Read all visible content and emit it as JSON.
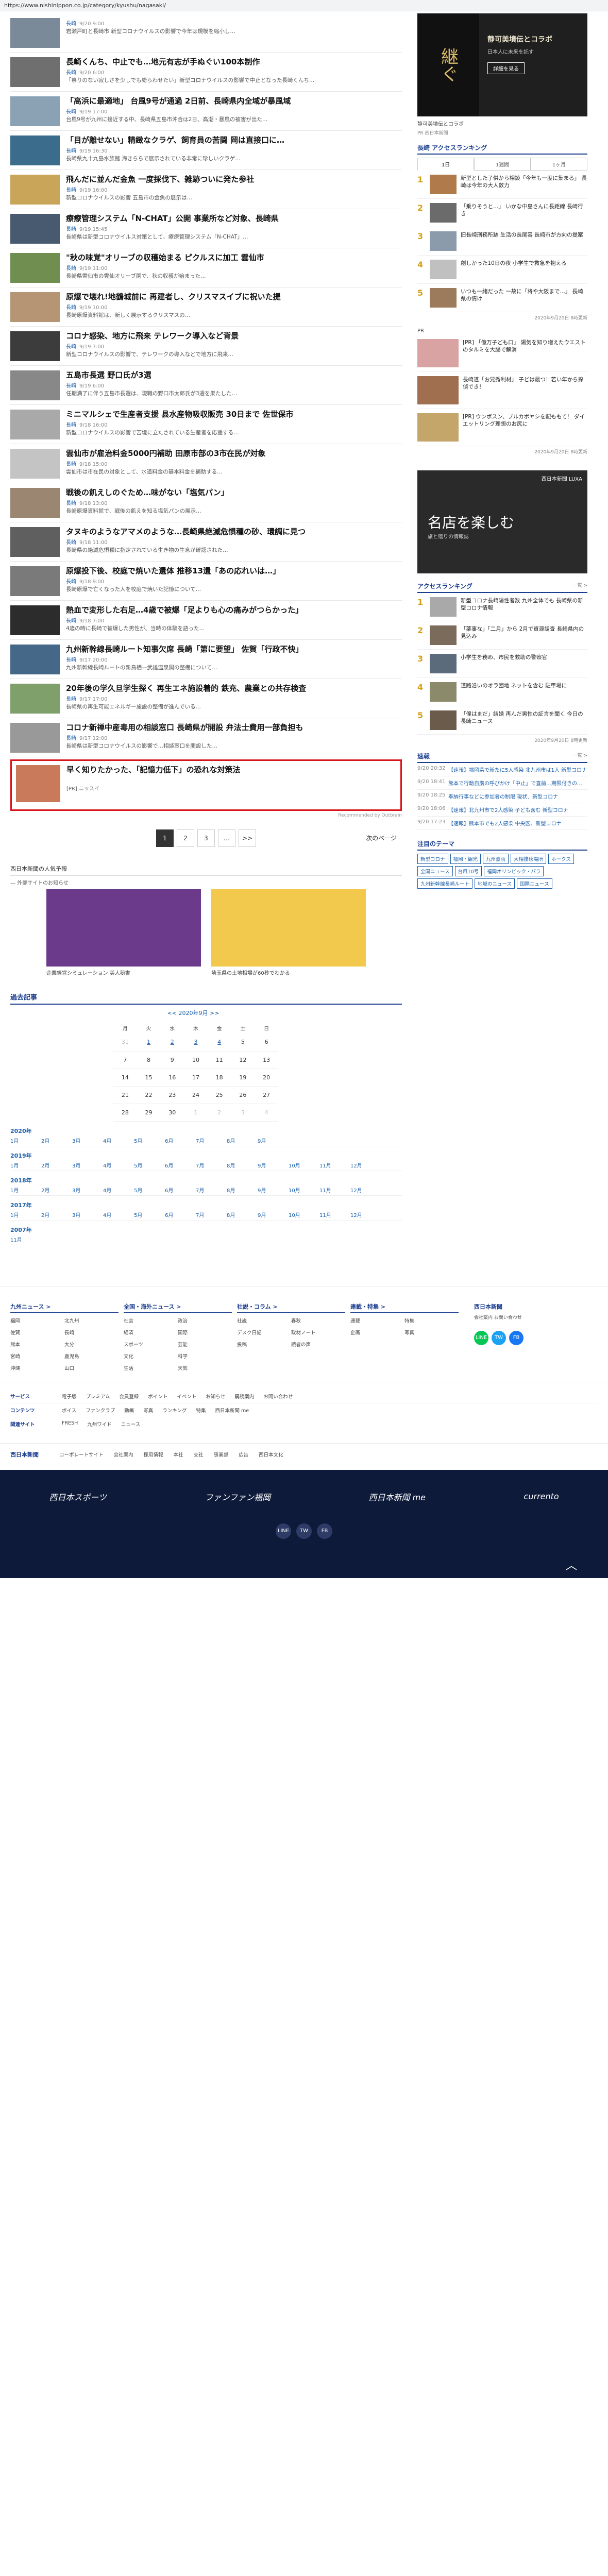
{
  "url": "https://www.nishinippon.co.jp/category/kyushu/nagasaki/",
  "articles": [
    {
      "title": "",
      "cat": "長崎",
      "time": "9/20 9:00",
      "lead": "岩瀬戸町と長崎市 新型コロナウイルスの影響で今年は規模を縮小し…",
      "color": "#7b8a99"
    },
    {
      "title": "長崎くんち、中止でも…地元有志が手ぬぐい100本制作",
      "cat": "長崎",
      "time": "9/20 6:00",
      "lead": "「祭りのない寂しさを少しでも紛らわせたい」新型コロナウイルスの影響で中止となった長崎くんち…",
      "color": "#6f6f6f"
    },
    {
      "title": "「高浜に最適地」 台風9号が通過 2日前、長崎県内全域が暴風域",
      "cat": "長崎",
      "time": "9/19 17:00",
      "lead": "台風9号が九州に接近する中、長崎県五島市沖合は2日、高潮・暴風の被害が出た…",
      "color": "#8aa2b4"
    },
    {
      "title": "「目が離せない」精緻なクラゲ、飼育員の苦闘 岡は直接口に…",
      "cat": "長崎",
      "time": "9/19 16:30",
      "lead": "長崎県九十九島水族館 海きららで展示されている非常に珍しいクラゲ…",
      "color": "#3b6c8c"
    },
    {
      "title": "飛んだに並んだ金魚 一度採伐下、雑跡ついに発た参社",
      "cat": "長崎",
      "time": "9/19 16:00",
      "lead": "新型コロナウイルスの影響 五島市の金魚の展示は…",
      "color": "#c9a55a"
    },
    {
      "title": "療療管理システム「N-CHAT」公開 事業所など対象、長崎県",
      "cat": "長崎",
      "time": "9/19 15:45",
      "lead": "長崎県は新型コロナウイルス対策として、療療管理システム「N-CHAT」…",
      "color": "#485a6f"
    },
    {
      "title": "\"秋の味覚\"オリーブの収穫始まる ピクルスに加工 雲仙市",
      "cat": "長崎",
      "time": "9/19 11:00",
      "lead": "長崎県雲仙市の雲仙オリーブ園で、秋の収穫が始まった…",
      "color": "#6f8e4f"
    },
    {
      "title": "原爆で壊れ!地鶴城前に 再建者し、クリスマスイブに祝いた提",
      "cat": "長崎",
      "time": "9/19 10:00",
      "lead": "長崎原爆資料館は、新しく展示するクリスマスの…",
      "color": "#b59574"
    },
    {
      "title": "コロナ感染、地方に飛来 テレワーク導入など背景",
      "cat": "長崎",
      "time": "9/19 7:00",
      "lead": "新型コロナウイルスの影響で、テレワークの導入などで地方に飛来…",
      "color": "#3c3c3c"
    },
    {
      "title": "五島市長選 野口氏が3選",
      "cat": "長崎",
      "time": "9/19 6:00",
      "lead": "任期満了に伴う五島市長選は、現職の野口市太郎氏が3選を果たした…",
      "color": "#888"
    },
    {
      "title": "ミニマルシェで生産者支援 县水産物吸収販売 30日まで 佐世保市",
      "cat": "長崎",
      "time": "9/18 16:00",
      "lead": "新型コロナウイルスの影響で苦境に立たされている生産者を応援する…",
      "color": "#a9a9a9"
    },
    {
      "title": "雲仙市が雇治料金5000円補助 田原市部の3市在民が対象",
      "cat": "長崎",
      "time": "9/18 15:00",
      "lead": "雲仙市は市在民の対象として、水道料金の基本料金を補助する…",
      "color": "#c4c4c4"
    },
    {
      "title": "戦後の飢えしのぐため…味がない「塩気パン」",
      "cat": "長崎",
      "time": "9/18 13:00",
      "lead": "長崎原爆資料館で、戦後の飢えを知る塩気パンの展示…",
      "color": "#9a8671"
    },
    {
      "title": "タヌキのようなアマメのような…長崎県絶滅危惧種の砂、環調に見つ",
      "cat": "長崎",
      "time": "9/18 11:00",
      "lead": "長崎県の絶滅危惧種に指定されている生き物の生息が確認された…",
      "color": "#5f5f5f"
    },
    {
      "title": "原爆投下後、校庭で焼いた遺体 推移13遺「あの応れいは…」",
      "cat": "長崎",
      "time": "9/18 9:00",
      "lead": "長崎原爆で亡くなった人を校庭で焼いた記憶について…",
      "color": "#7a7a7a"
    },
    {
      "title": "熱血で変形した右足…4歳で被爆「足よりも心の痛みがつらかった」",
      "cat": "長崎",
      "time": "9/18 7:00",
      "lead": "4歳の時に長崎で被爆した男性が、当時の体験を語った…",
      "color": "#2c2c2c"
    },
    {
      "title": "九州新幹線長崎ルート知事欠席 長崎「第に要望」 佐賀「行政不快」",
      "cat": "長崎",
      "time": "9/17 20:00",
      "lead": "九州新幹線長崎ルートの新鳥栖―武雄温泉間の整備について…",
      "color": "#456788"
    },
    {
      "title": "20年後の学久旦学生探く 再生エネ施設着的 鉄充、農業との共存検査",
      "cat": "長崎",
      "time": "9/17 17:00",
      "lead": "長崎県の再生可能エネルギー施設の整備が進んでいる…",
      "color": "#7fa06a"
    },
    {
      "title": "コロナ新禅中産毒用の相談窓口 長崎県が開設 弁法士費用一部負担も",
      "cat": "長崎",
      "time": "9/17 12:00",
      "lead": "長崎県は新型コロナウイルスの影響で…相談窓口を開設した…",
      "color": "#999"
    }
  ],
  "pr_article": {
    "title": "早く知りたかった、「記憶力低下」の恐れな対策法",
    "tag": "[PR] ニッスイ",
    "color": "#c97a5a"
  },
  "recommend_label": "Recommended by Outbrain",
  "pager": {
    "pages": [
      "1",
      "2",
      "3",
      "…",
      ">>"
    ],
    "next": "次のページ"
  },
  "promo": {
    "heading": "西日本新聞の人気予報",
    "sub": "— 外部サイトのお知らせ",
    "cards": [
      {
        "caption": "企業経営シミュレーション 美人秘書",
        "color": "#6b3a8a"
      },
      {
        "caption": "埼玉県の土地相場が60秒でわかる",
        "color": "#f2c94c"
      }
    ]
  },
  "archive": {
    "heading": "過去記事",
    "month_title": "<< 2020年9月 >>",
    "weekdays": [
      "月",
      "火",
      "水",
      "木",
      "金",
      "土",
      "日"
    ],
    "weeks": [
      [
        {
          "d": "31",
          "c": "dim"
        },
        {
          "d": "1",
          "c": "link"
        },
        {
          "d": "2",
          "c": "link"
        },
        {
          "d": "3",
          "c": "link"
        },
        {
          "d": "4",
          "c": "link"
        },
        {
          "d": "5",
          "c": ""
        },
        {
          "d": "6",
          "c": ""
        }
      ],
      [
        {
          "d": "7",
          "c": ""
        },
        {
          "d": "8",
          "c": ""
        },
        {
          "d": "9",
          "c": ""
        },
        {
          "d": "10",
          "c": ""
        },
        {
          "d": "11",
          "c": ""
        },
        {
          "d": "12",
          "c": ""
        },
        {
          "d": "13",
          "c": ""
        }
      ],
      [
        {
          "d": "14",
          "c": ""
        },
        {
          "d": "15",
          "c": ""
        },
        {
          "d": "16",
          "c": ""
        },
        {
          "d": "17",
          "c": ""
        },
        {
          "d": "18",
          "c": ""
        },
        {
          "d": "19",
          "c": ""
        },
        {
          "d": "20",
          "c": ""
        }
      ],
      [
        {
          "d": "21",
          "c": ""
        },
        {
          "d": "22",
          "c": ""
        },
        {
          "d": "23",
          "c": ""
        },
        {
          "d": "24",
          "c": ""
        },
        {
          "d": "25",
          "c": ""
        },
        {
          "d": "26",
          "c": ""
        },
        {
          "d": "27",
          "c": ""
        }
      ],
      [
        {
          "d": "28",
          "c": ""
        },
        {
          "d": "29",
          "c": ""
        },
        {
          "d": "30",
          "c": ""
        },
        {
          "d": "1",
          "c": "dim"
        },
        {
          "d": "2",
          "c": "dim"
        },
        {
          "d": "3",
          "c": "dim"
        },
        {
          "d": "4",
          "c": "dim"
        }
      ]
    ],
    "years": [
      {
        "year": "2020年",
        "months": [
          "1月",
          "2月",
          "3月",
          "4月",
          "5月",
          "6月",
          "7月",
          "8月",
          "9月"
        ]
      },
      {
        "year": "2019年",
        "months": [
          "1月",
          "2月",
          "3月",
          "4月",
          "5月",
          "6月",
          "7月",
          "8月",
          "9月",
          "10月",
          "11月",
          "12月"
        ]
      },
      {
        "year": "2018年",
        "months": [
          "1月",
          "2月",
          "3月",
          "4月",
          "5月",
          "6月",
          "7月",
          "8月",
          "9月",
          "10月",
          "11月",
          "12月"
        ]
      },
      {
        "year": "2017年",
        "months": [
          "1月",
          "2月",
          "3月",
          "4月",
          "5月",
          "6月",
          "7月",
          "8月",
          "9月",
          "10月",
          "11月",
          "12月"
        ]
      },
      {
        "year": "2007年",
        "months": [
          "11月"
        ]
      }
    ]
  },
  "sidebar": {
    "ad1": {
      "vertical": "継ぐ",
      "title": "静可美墳伝とコラボ",
      "sub": "日本人に未来を託す",
      "button": "詳細を見る"
    },
    "ad1_caption": "静可美墳伝とコラボ",
    "ad1_sub": "PR 西日本新聞",
    "rank_heading": "長崎 アクセスランキング",
    "tabs": [
      "1日",
      "1週間",
      "1ヶ月"
    ],
    "ranks": [
      {
        "no": "1",
        "title": "新型とした子供から相談「今年も一度に集まる」 長崎は今年の大人数力",
        "color": "#b07a4a"
      },
      {
        "no": "2",
        "title": "「乗りそうと…」 いかな中島さんに長距線 長崎行き",
        "color": "#6b6b6b"
      },
      {
        "no": "3",
        "title": "旧長崎刑務所跡 生活の長尾容 長崎市が方向の提案",
        "color": "#8b9bab"
      },
      {
        "no": "4",
        "title": "創しかった10日の夜 小学生で救急を抱える",
        "color": "#c0c0c0"
      },
      {
        "no": "5",
        "title": "いつも一緒だった 一故に「将や大阪まで…」 長崎県の情け",
        "color": "#9b7b5b"
      }
    ],
    "rank_foot": "2020年9月20日 8時更新",
    "pr_label": "PR",
    "news": [
      {
        "title": "[PR] 「億万子ども口」 陽気を知り増えたウエストのタルミを大腸で解消",
        "color": "#d9a3a3"
      },
      {
        "title": "長崎道「お兄秀利材」 子どは最つ！若い年から探偵でき！",
        "color": "#9f6f4f"
      },
      {
        "title": "[PR] ウンボスン、ブルカボヤシを配ももて！ ダイエットリング理想のお尻に",
        "color": "#c4a66b"
      }
    ],
    "news_foot": "2020年9月20日 8時更新",
    "ad2": {
      "big": "名店を楽しむ",
      "sub": "旅と贈りの情報誌",
      "logo": "西日本新聞 LUXA"
    },
    "rank2_heading": "アクセスランキング",
    "rank2_more": "一覧 >",
    "ranks2": [
      {
        "no": "1",
        "title": "新型コロナ長崎陽性者数 九州全体でも 長崎県の新型コロナ情報",
        "color": "#a9a9a9"
      },
      {
        "no": "2",
        "title": "「薬事な」「二月」から 2月で資源調査 長崎県内の見込み",
        "color": "#7b6b5b"
      },
      {
        "no": "3",
        "title": "小学生を務め、市民を救助の警察官",
        "color": "#5b6b7b"
      },
      {
        "no": "4",
        "title": "道路沿いのオラ団地 ネットを含む 駐車場に",
        "color": "#8b8b6b"
      },
      {
        "no": "5",
        "title": "「僕はまだ」結婚 再んだ男性の証言を聞く 今日の長崎ニュース",
        "color": "#6b5b4b"
      }
    ],
    "rank2_foot": "2020年9月20日 8時更新",
    "live_heading": "速報",
    "live_more": "一覧 >",
    "live": [
      {
        "time": "9/20 20:32",
        "text": "【速報】福岡県で新たに5人感染 北九州市は1人 新型コロナ"
      },
      {
        "time": "9/20 18:41",
        "text": "熊本で行動自粛の呼びかけ「中止」で直前…期限付きの…"
      },
      {
        "time": "9/20 18:25",
        "text": "奉納行事などに参加者の制限 現状、新型コロナ"
      },
      {
        "time": "9/20 18:06",
        "text": "【速報】北九州市で2人感染 子ども含む 新型コロナ"
      },
      {
        "time": "9/20 17:23",
        "text": "【速報】熊本市でも2人感染 中央区、新型コロナ"
      }
    ],
    "theme_heading": "注目のテーマ",
    "tags": [
      "新型コロナ",
      "福岡・観光",
      "九州豪雨",
      "大相撲秋場所",
      "ホークス",
      "全国ニュース",
      "台風10号",
      "福岡オリンピック・パラ",
      "九州新幹線長崎ルート",
      "地域のニュース",
      "国際ニュース"
    ]
  },
  "footer": {
    "cols": [
      {
        "title": "九州ニュース >",
        "items": [
          "福岡",
          "北九州",
          "佐賀",
          "長崎",
          "熊本",
          "大分",
          "宮崎",
          "鹿児島",
          "沖縄",
          "山口"
        ]
      },
      {
        "title": "全国・海外ニュース >",
        "items": [
          "社会",
          "政治",
          "経済",
          "国際",
          "スポーツ",
          "芸能",
          "文化",
          "科学",
          "生活",
          "天気"
        ]
      },
      {
        "title": "社説・コラム >",
        "items": [
          "社説",
          "春秋",
          "デスク日記",
          "取材ノート",
          "投稿",
          "読者の声"
        ]
      },
      {
        "title": "連載・特集 >",
        "items": [
          "連載",
          "特集",
          "企画",
          "写真"
        ]
      }
    ],
    "brand": "西日本新聞",
    "brand_links": "会社案内 お問い合わせ",
    "social": [
      "LINE",
      "TW",
      "FB"
    ],
    "svc": [
      {
        "label": "サービス",
        "items": [
          "電子版",
          "プレミアム",
          "会員登録",
          "ポイント",
          "イベント",
          "お知らせ",
          "購読案内",
          "お問い合わせ"
        ]
      },
      {
        "label": "コンテンツ",
        "items": [
          "ボイス",
          "ファンクラブ",
          "動画",
          "写真",
          "ランキング",
          "特集",
          "西日本新聞 me"
        ]
      },
      {
        "label": "関連サイト",
        "items": [
          "FRESH",
          "九州ワイド",
          "ニュース"
        ]
      }
    ],
    "corp_logo": "西日本新聞",
    "corp_links": [
      "コーポレートサイト",
      "会社案内",
      "採用情報",
      "本社",
      "支社",
      "事業部",
      "広告",
      "西日本文化"
    ],
    "brands": [
      "西日本スポーツ",
      "ファンファン福岡",
      "西日本新聞 me",
      "currento"
    ],
    "bsocial": [
      "LINE",
      "TW",
      "FB"
    ],
    "totop": "︿"
  }
}
